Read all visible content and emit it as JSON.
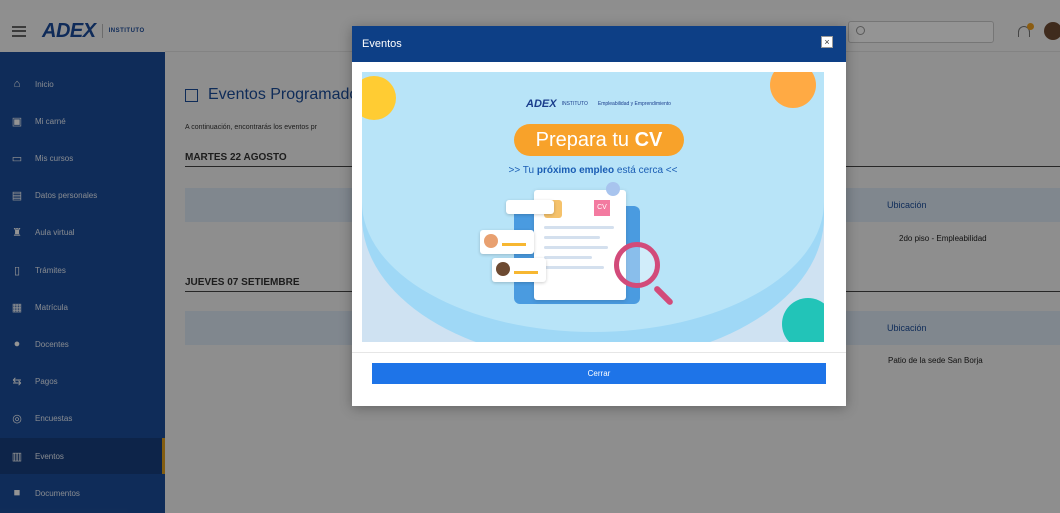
{
  "header": {
    "logo": "ADEX",
    "logo_sub": "INSTITUTO"
  },
  "sidebar": {
    "items": [
      {
        "label": "Inicio",
        "icon": "home-icon"
      },
      {
        "label": "Mi carné",
        "icon": "id-card-icon"
      },
      {
        "label": "Mis cursos",
        "icon": "monitor-icon"
      },
      {
        "label": "Datos personales",
        "icon": "profile-card-icon"
      },
      {
        "label": "Aula virtual",
        "icon": "building-icon"
      },
      {
        "label": "Trámites",
        "icon": "document-icon"
      },
      {
        "label": "Matrícula",
        "icon": "enrollment-icon"
      },
      {
        "label": "Docentes",
        "icon": "person-icon"
      },
      {
        "label": "Pagos",
        "icon": "transfer-icon"
      },
      {
        "label": "Encuestas",
        "icon": "survey-icon"
      },
      {
        "label": "Eventos",
        "icon": "calendar-icon"
      },
      {
        "label": "Documentos",
        "icon": "folder-icon"
      }
    ],
    "active_index": 10
  },
  "main": {
    "title": "Eventos Programado",
    "intro": "A continuación, encontrarás los eventos pr",
    "days": [
      {
        "heading": "MARTES 22 AGOSTO",
        "column": "Ubicación",
        "location": "2do piso - Empleabilidad"
      },
      {
        "heading": "JUEVES 07 SETIEMBRE",
        "column": "Ubicación",
        "location": "Patio de la sede San Borja"
      }
    ]
  },
  "modal": {
    "title": "Eventos",
    "close_x": "×",
    "button": "Cerrar",
    "banner": {
      "logo": "ADEX",
      "logo_sub": "INSTITUTO",
      "partner": "Empleabilidad y Emprendimiento",
      "headline_pre": "Prepara tu ",
      "headline_bold": "CV",
      "tagline_pre": ">> Tu ",
      "tagline_bold": "próximo empleo",
      "tagline_post": " está cerca <<",
      "cv_tag": "CV"
    }
  },
  "colors": {
    "sidebar": "#1b4d9a",
    "modal_header": "#0d3f86",
    "button": "#1e74e8",
    "accent": "#f8a22a"
  }
}
